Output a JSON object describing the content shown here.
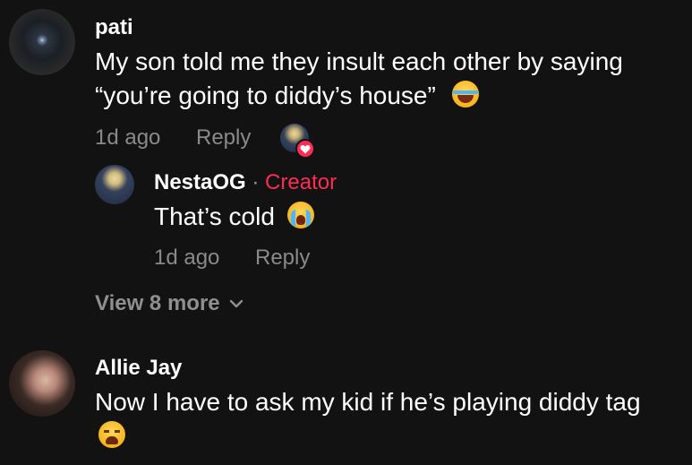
{
  "comments": [
    {
      "username": "pati",
      "text_line1": "My son told me they insult each other by saying",
      "text_line2": "“you’re going to diddy’s house”",
      "emoji": "laughing-emoji",
      "time": "1d ago",
      "reply_label": "Reply",
      "reply": {
        "username": "NestaOG",
        "separator": "·",
        "badge": "Creator",
        "text": "That’s cold",
        "emoji": "crying-emoji",
        "time": "1d ago",
        "reply_label": "Reply"
      },
      "view_more": "View 8 more"
    },
    {
      "username": "Allie Jay",
      "text_line1": "Now I have to ask my kid if he’s playing diddy tag",
      "emoji": "weary-emoji"
    }
  ],
  "colors": {
    "background": "#121212",
    "primary_text": "#ffffff",
    "secondary_text": "#8a8a8a",
    "creator_accent": "#fe2c55"
  }
}
